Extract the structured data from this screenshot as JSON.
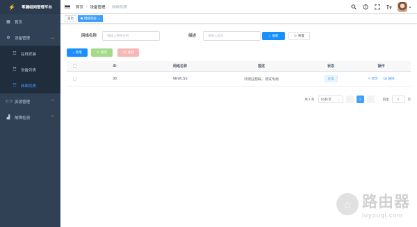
{
  "app": {
    "title": "零漏组网管理平台"
  },
  "sidebar": {
    "items": [
      {
        "label": "首页",
        "icon": "dashboard-icon"
      },
      {
        "label": "设备管理",
        "icon": "gear-icon",
        "expanded": true,
        "children": [
          {
            "label": "在线安装"
          },
          {
            "label": "设备列表"
          },
          {
            "label": "网络列表",
            "active": true
          }
        ]
      },
      {
        "label": "资源管理",
        "icon": "link-icon"
      },
      {
        "label": "故障检测",
        "icon": "chart-icon"
      }
    ]
  },
  "navbar": {
    "breadcrumb": [
      "首页",
      "设备管理",
      "网络列表"
    ],
    "separator": "/"
  },
  "tags": [
    {
      "label": "首页"
    },
    {
      "label": "网络列表",
      "active": true
    }
  ],
  "search": {
    "name_label": "网络名称",
    "name_placeholder": "请输入网络名称",
    "desc_label": "描述",
    "desc_placeholder": "请输入描述",
    "search_btn": "搜索",
    "reset_btn": "重置"
  },
  "toolbar": {
    "add_btn": "新增",
    "edit_btn": "修改",
    "delete_btn": "删除"
  },
  "table": {
    "columns": [
      "ID",
      "网络名称",
      "描述",
      "状态",
      "操作"
    ],
    "rows": [
      {
        "id": "98",
        "name": "NEWLSS",
        "desc": "评测狂想曲，测试专用",
        "status": "正常",
        "op_edit": "修改",
        "op_delete": "删除"
      }
    ]
  },
  "pagination": {
    "total": "共 1 条",
    "page_size": "10条/页",
    "current_page": "1",
    "goto_label": "前往",
    "goto_value": "1",
    "page_suffix": "页"
  },
  "watermark": {
    "cn": "路由器",
    "en": "luyouqi.com"
  },
  "colors": {
    "sidebar_bg": "#304156",
    "primary": "#1890ff",
    "active_menu": "#409eff"
  }
}
